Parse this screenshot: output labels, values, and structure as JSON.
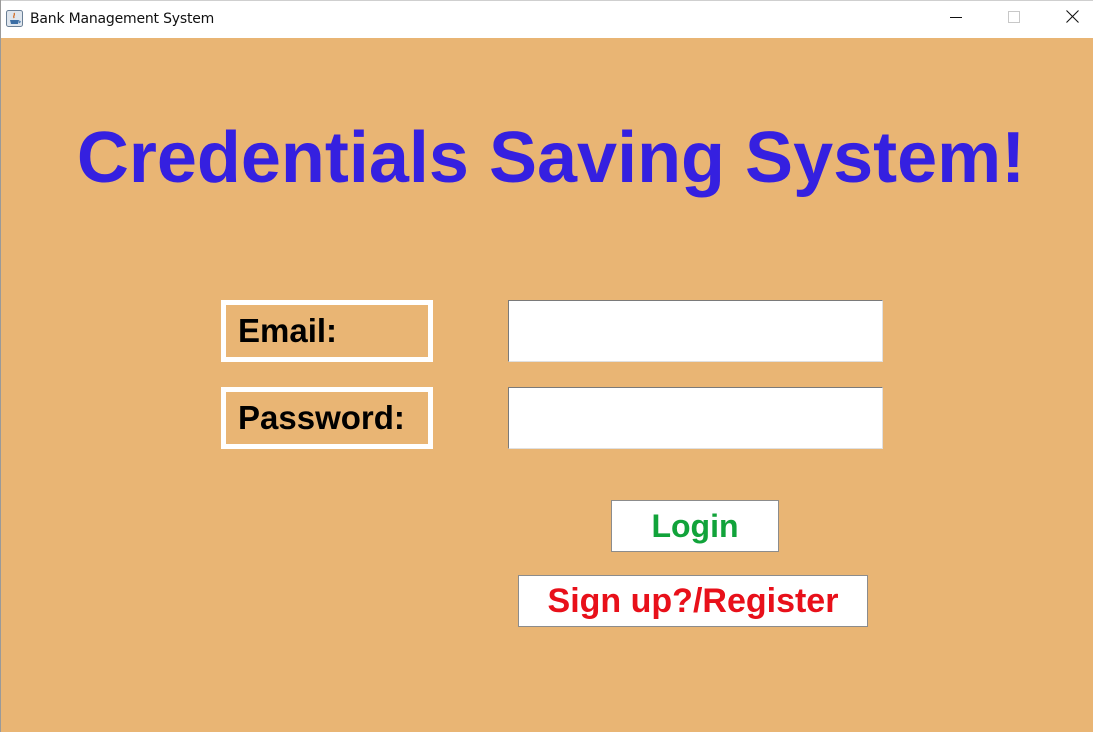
{
  "window": {
    "title": "Bank Management System",
    "icons": {
      "app": "java-app-icon",
      "minimize": "minimize-icon",
      "maximize": "maximize-icon",
      "close": "close-icon"
    }
  },
  "main": {
    "headline": "Credentials Saving System!",
    "email_label": "Email:",
    "email_value": "",
    "password_label": "Password:",
    "password_value": "",
    "login_label": "Login",
    "register_label": "Sign up?/Register"
  },
  "colors": {
    "background": "#e9b574",
    "headline": "#3520e0",
    "login_text": "#11a33a",
    "register_text": "#e8101a"
  }
}
